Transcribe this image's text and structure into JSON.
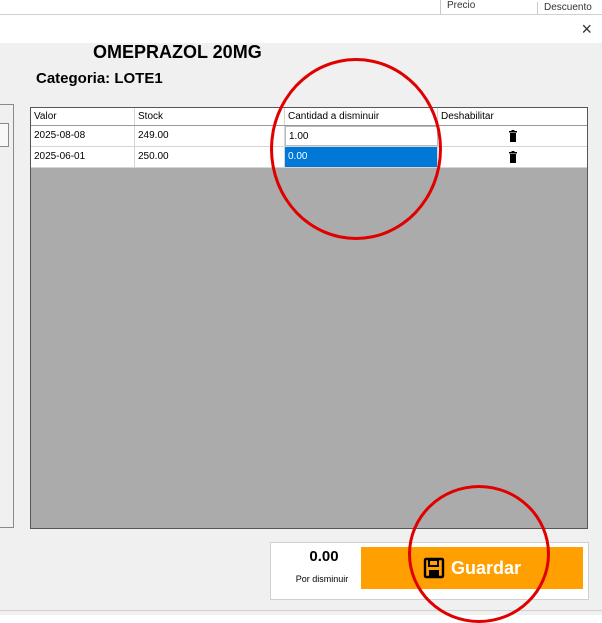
{
  "background": {
    "col_a": "Precio",
    "col_b": "Descuento"
  },
  "dialog": {
    "close_glyph": "×",
    "product_name": "OMEPRAZOL 20MG",
    "category": "Categoria: LOTE1"
  },
  "table": {
    "headers": [
      "Valor",
      "Stock",
      "Cantidad a disminuir",
      "Deshabilitar"
    ],
    "rows": [
      {
        "valor": "2025-08-08",
        "stock": "249.00",
        "cantidad": "1.00",
        "selected": false
      },
      {
        "valor": "2025-06-01",
        "stock": "250.00",
        "cantidad": "0.00",
        "selected": true
      }
    ],
    "action_icon": "trash-icon"
  },
  "footer": {
    "amount": "0.00",
    "amount_label": "Por disminuir",
    "save_label": "Guardar",
    "save_icon": "floppy-disk-icon"
  },
  "colors": {
    "accent": "#ff9f00",
    "selection": "#0078d7",
    "grid_bg": "#ababab",
    "annotation": "#e00000"
  }
}
